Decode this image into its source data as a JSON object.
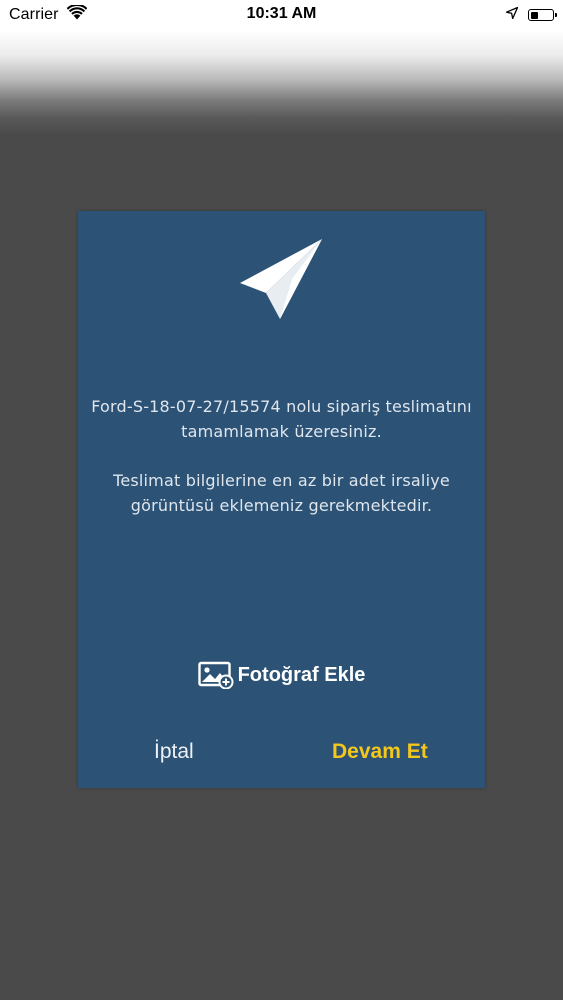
{
  "status_bar": {
    "carrier": "Carrier",
    "time": "10:31 AM",
    "battery_level": 0.35,
    "icons": [
      "wifi-icon",
      "location-arrow-icon",
      "battery-icon"
    ]
  },
  "dialog": {
    "icon": "paper-plane-icon",
    "message_line1": "Ford-S-18-07-27/15574 nolu sipariş teslimatını tamamlamak üzeresiniz.",
    "message_line2": "Teslimat bilgilerine en az bir adet irsaliye görüntüsü eklemeniz gerekmektedir.",
    "add_photo_icon": "add-photo-icon",
    "add_photo_label": "Fotoğraf Ekle",
    "cancel_label": "İptal",
    "continue_label": "Devam Et"
  },
  "colors": {
    "dialog_background": "#2c5275",
    "overlay": "#4b4a4b",
    "continue_accent": "#f3c71b",
    "text_light": "#dfe6ee"
  }
}
